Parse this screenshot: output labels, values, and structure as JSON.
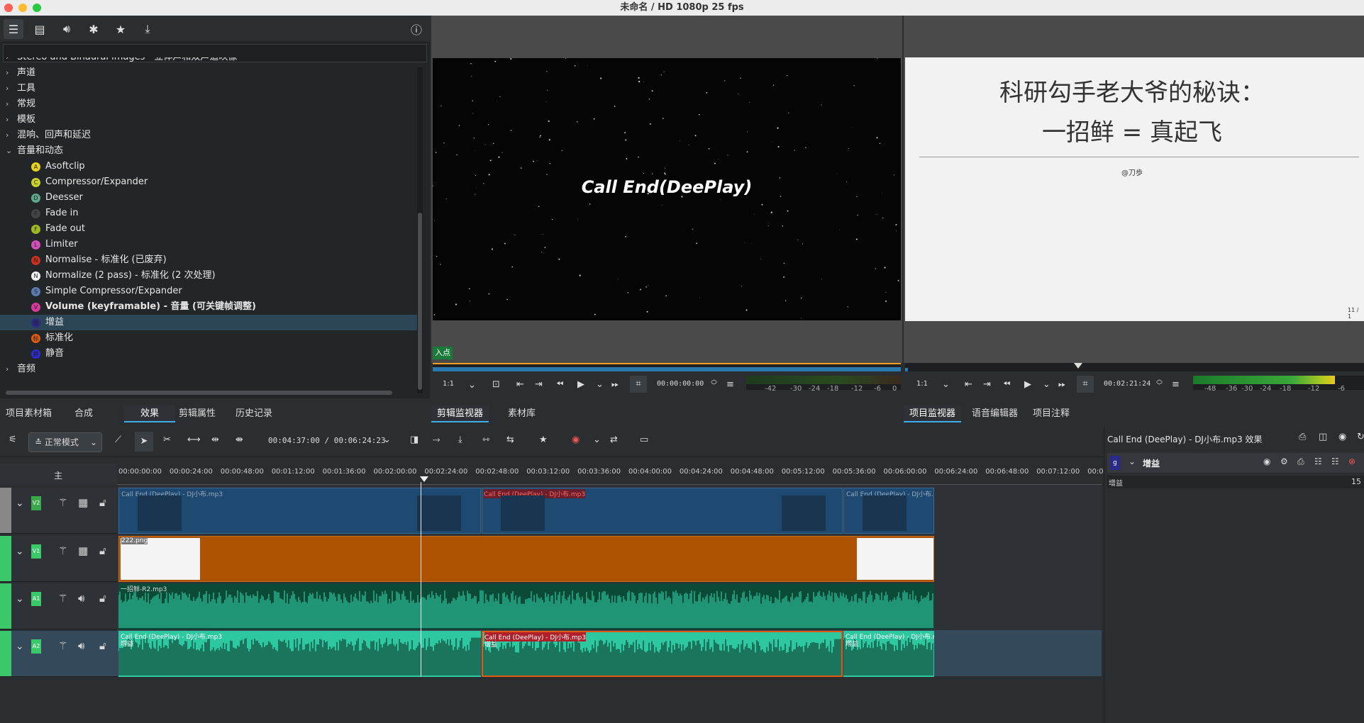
{
  "window": {
    "title": "未命名 / HD 1080p 25 fps"
  },
  "effects_panel": {
    "toolbar_icons": [
      "list-icon",
      "video-effects-icon",
      "audio-effects-icon",
      "custom-effects-icon",
      "favorites-icon",
      "download-icon",
      "info-icon"
    ],
    "search_placeholder": "",
    "tree": [
      {
        "label": "Stereo and Binaural images - 立体声和双声道映像",
        "type": "category",
        "expanded": false
      },
      {
        "label": "声道",
        "type": "category",
        "expanded": false
      },
      {
        "label": "工具",
        "type": "category",
        "expanded": false
      },
      {
        "label": "常规",
        "type": "category",
        "expanded": false
      },
      {
        "label": "模板",
        "type": "category",
        "expanded": false
      },
      {
        "label": "混响、回声和延迟",
        "type": "category",
        "expanded": false
      },
      {
        "label": "音量和动态",
        "type": "category",
        "expanded": true
      },
      {
        "label": "Asoftclip",
        "type": "effect",
        "letter": "A",
        "color": "#e6d21a"
      },
      {
        "label": "Compressor/Expander",
        "type": "effect",
        "letter": "C",
        "color": "#c8d22a"
      },
      {
        "label": "Deesser",
        "type": "effect",
        "letter": "D",
        "color": "#5fa88e"
      },
      {
        "label": "Fade in",
        "type": "effect",
        "letter": "F",
        "color": "#404448"
      },
      {
        "label": "Fade out",
        "type": "effect",
        "letter": "F",
        "color": "#a0b820"
      },
      {
        "label": "Limiter",
        "type": "effect",
        "letter": "L",
        "color": "#d050b8"
      },
      {
        "label": "Normalise - 标准化 (已废弃)",
        "type": "effect",
        "letter": "N",
        "color": "#c83020"
      },
      {
        "label": "Normalize (2 pass) - 标准化 (2 次处理)",
        "type": "effect",
        "letter": "N",
        "color": "#f0f0f0"
      },
      {
        "label": "Simple Compressor/Expander",
        "type": "effect",
        "letter": "S",
        "color": "#5a7ab0"
      },
      {
        "label": "Volume (keyframable) - 音量 (可关键帧调整)",
        "type": "effect",
        "letter": "V",
        "color": "#d83a9a",
        "bold": true
      },
      {
        "label": "增益",
        "type": "effect",
        "letter": "增",
        "color": "#2a2a8a",
        "selected": true
      },
      {
        "label": "标准化",
        "type": "effect",
        "letter": "标",
        "color": "#e05a10"
      },
      {
        "label": "静音",
        "type": "effect",
        "letter": "静",
        "color": "#2a2ad8"
      },
      {
        "label": "音频",
        "type": "category",
        "expanded": false
      }
    ]
  },
  "bottom_tabs_left": [
    "项目素材箱",
    "合成",
    "效果",
    "剪辑属性",
    "历史记录"
  ],
  "bottom_tabs_left_active": "效果",
  "clip_monitor": {
    "overlay_text": "Call End(DeePlay)",
    "in_point_label": "入点",
    "zoom": "1:1",
    "timecode": "00:00:00:00",
    "meter_labels": [
      "-42",
      "-30",
      "-24",
      "-18",
      "-12",
      "-6",
      "0"
    ],
    "tabs": [
      "剪辑监视器",
      "素材库"
    ],
    "active_tab": "剪辑监视器"
  },
  "project_monitor": {
    "title_line1": "科研勾手老大爷的秘诀：",
    "title_line2": "一招鲜 = 真起飞",
    "author": "@刀歩",
    "page_number": "11 / 1",
    "zoom": "1:1",
    "timecode": "00:02:21:24",
    "meter_labels": [
      "-48",
      "-36",
      "-30",
      "-24",
      "-18",
      "-12",
      "-6"
    ],
    "tabs": [
      "项目监视器",
      "语音编辑器",
      "项目注释"
    ],
    "active_tab": "项目监视器"
  },
  "timeline_toolbar": {
    "mode": "正常模式",
    "position": "00:04:37:00 / 00:06:24:23"
  },
  "timeline": {
    "master_label": "主",
    "ruler": [
      "00:00:00:00",
      "00:00:24:00",
      "00:00:48:00",
      "00:01:12:00",
      "00:01:36:00",
      "00:02:00:00",
      "00:02:24:00",
      "00:02:48:00",
      "00:03:12:00",
      "00:03:36:00",
      "00:04:00:00",
      "00:04:24:00",
      "00:04:48:00",
      "00:05:12:00",
      "00:05:36:00",
      "00:06:00:00",
      "00:06:24:00",
      "00:06:48:00",
      "00:07:12:00",
      "00:0"
    ],
    "tracks": [
      {
        "id": "V2",
        "type": "video"
      },
      {
        "id": "V1",
        "type": "video"
      },
      {
        "id": "A1",
        "type": "audio"
      },
      {
        "id": "A2",
        "type": "audio"
      }
    ],
    "clips": {
      "v2_a": "Call End (DeePlay) - DJ小布.mp3",
      "v2_b": "Call End (DeePlay) - DJ小布.mp3",
      "v2_c": "Call End (DeePlay) - DJ小布.mp3",
      "v1_a": "222.png",
      "a1_a": "一招鲜-R2.mp3",
      "a2_a": "Call End (DeePlay) - DJ小布.mp3",
      "a2_b": "Call End (DeePlay) - DJ小布.mp3",
      "a2_c": "Call End (DeePlay) - DJ小布.mp3",
      "gain_tag": "增益"
    }
  },
  "effect_stack": {
    "title": "Call End (DeePlay) - DJ小布.mp3 效果",
    "effect_name": "增益",
    "param_label": "增益",
    "param_value": "15"
  }
}
